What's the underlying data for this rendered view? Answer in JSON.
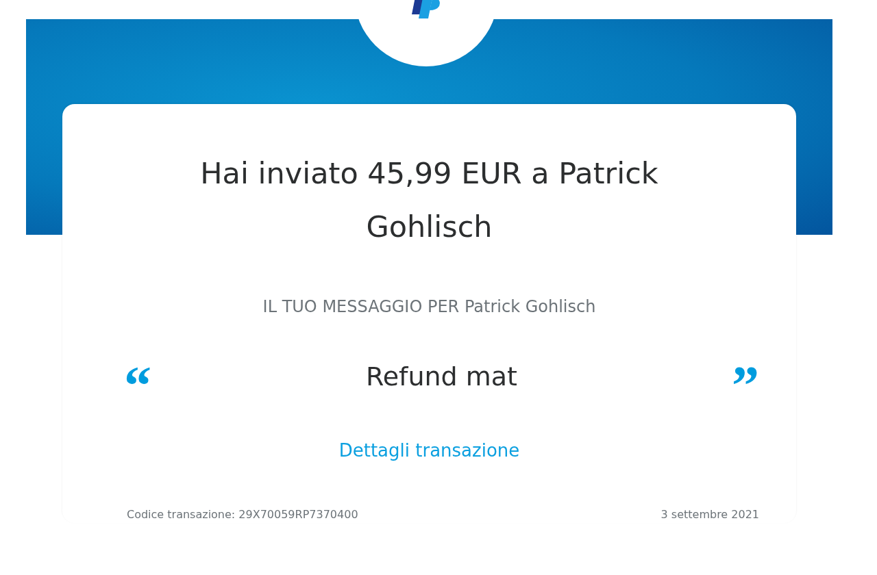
{
  "title": "Hai inviato 45,99 EUR a Patrick Gohlisch",
  "message_label": "IL TUO MESSAGGIO PER Patrick Gohlisch",
  "message": {
    "open_quote": "“",
    "text": "Refund mat",
    "close_quote": "”"
  },
  "details_link": "Dettagli transazione",
  "footer": {
    "transaction_code": "Codice transazione: 29X70059RP7370400",
    "date": "3 settembre 2021"
  }
}
